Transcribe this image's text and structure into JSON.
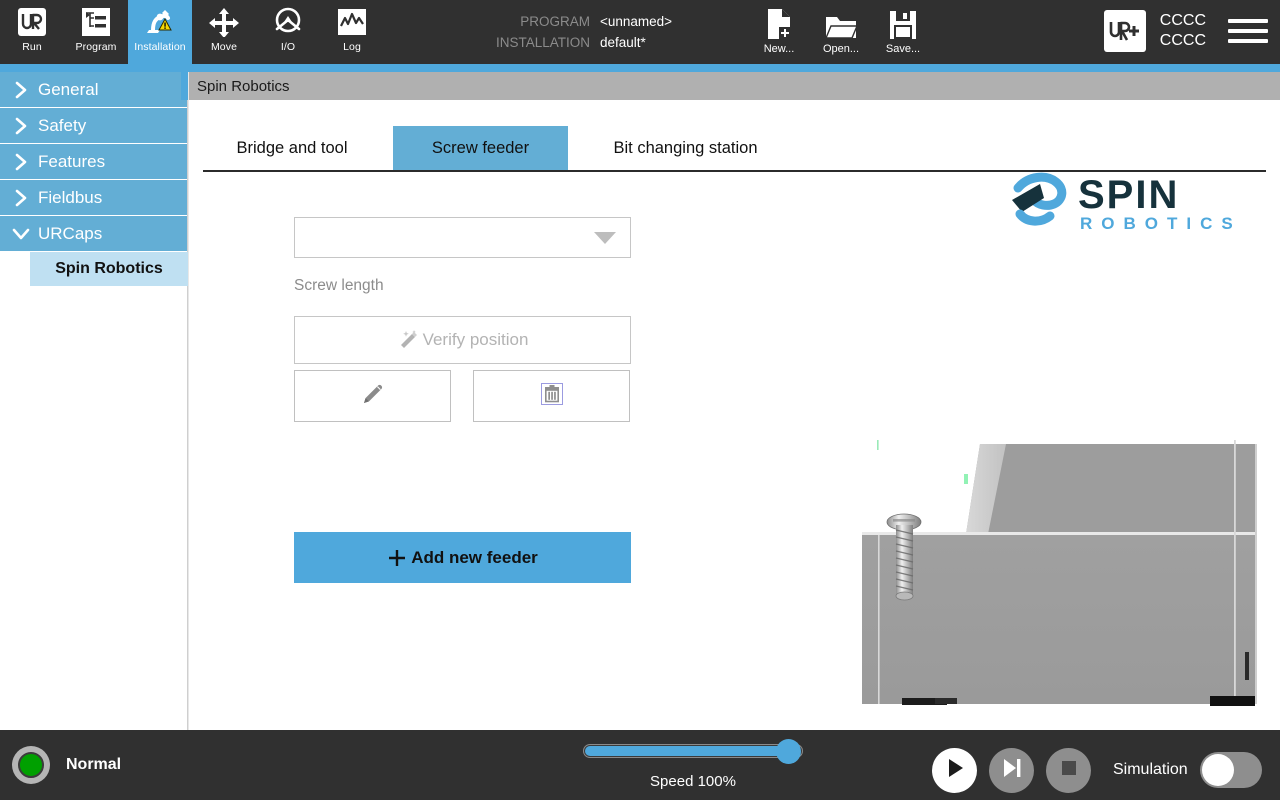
{
  "header": {
    "nav": [
      {
        "label": "Run",
        "icon": "ur-logo-icon",
        "active": false
      },
      {
        "label": "Program",
        "icon": "program-tree-icon",
        "active": false
      },
      {
        "label": "Installation",
        "icon": "robot-arm-warning-icon",
        "active": true
      },
      {
        "label": "Move",
        "icon": "move-arrows-icon",
        "active": false
      },
      {
        "label": "I/O",
        "icon": "io-gauge-icon",
        "active": false
      },
      {
        "label": "Log",
        "icon": "log-waveform-icon",
        "active": false
      }
    ],
    "meta": [
      {
        "key": "PROGRAM",
        "value": "<unnamed>"
      },
      {
        "key": "INSTALLATION",
        "value": "default*"
      }
    ],
    "file_buttons": [
      {
        "label": "New...",
        "icon": "new-file-icon"
      },
      {
        "label": "Open...",
        "icon": "open-folder-icon"
      },
      {
        "label": "Save...",
        "icon": "save-floppy-icon"
      }
    ],
    "urplus_badge": "urplus-icon",
    "account_lines": [
      "CCCC",
      "CCCC"
    ],
    "menu_icon": "hamburger-menu-icon"
  },
  "sidebar": {
    "items": [
      {
        "label": "General",
        "icon": "chevron-right-icon",
        "expanded": false
      },
      {
        "label": "Safety",
        "icon": "chevron-right-icon",
        "expanded": false
      },
      {
        "label": "Features",
        "icon": "chevron-right-icon",
        "expanded": false
      },
      {
        "label": "Fieldbus",
        "icon": "chevron-right-icon",
        "expanded": false
      },
      {
        "label": "URCaps",
        "icon": "chevron-down-icon",
        "expanded": true
      }
    ],
    "sub_item": "Spin Robotics"
  },
  "content": {
    "title": "Spin Robotics",
    "tabs": [
      {
        "label": "Bridge and tool",
        "active": false
      },
      {
        "label": "Screw feeder",
        "active": true
      },
      {
        "label": "Bit changing station",
        "active": false
      }
    ],
    "screw_length": {
      "value": "",
      "label": "Screw length",
      "caret_icon": "chevron-down-icon"
    },
    "verify_button": {
      "label": "Verify position",
      "icon": "magic-wand-icon",
      "disabled": true
    },
    "edit_button": {
      "icon": "pencil-edit-icon"
    },
    "delete_button": {
      "icon": "trash-delete-icon"
    },
    "add_button": {
      "label": "Add new feeder",
      "icon": "plus-icon"
    },
    "logo": {
      "word": "SPIN",
      "subtitle": "ROBOTICS",
      "mark": "spin-swoosh-icon",
      "word_color": "#16323c",
      "subtitle_color": "#4fa8dc"
    },
    "illustration": "screw-feeder-cad-illustration"
  },
  "footer": {
    "robot_state": "Normal",
    "state_color": "#00a000",
    "speed": {
      "label": "Speed 100%",
      "percent": 100
    },
    "transport": [
      {
        "icon": "play-icon",
        "enabled": true
      },
      {
        "icon": "step-icon",
        "enabled": false
      },
      {
        "icon": "stop-icon",
        "enabled": false
      }
    ],
    "simulation": {
      "label": "Simulation",
      "on": false
    }
  },
  "colors": {
    "accent_blue": "#4fa8dc",
    "sidebar_blue": "#63aed5",
    "sub_item_blue": "#bfe0f2",
    "header_dark": "#303030",
    "title_grey": "#b0b0b0"
  }
}
